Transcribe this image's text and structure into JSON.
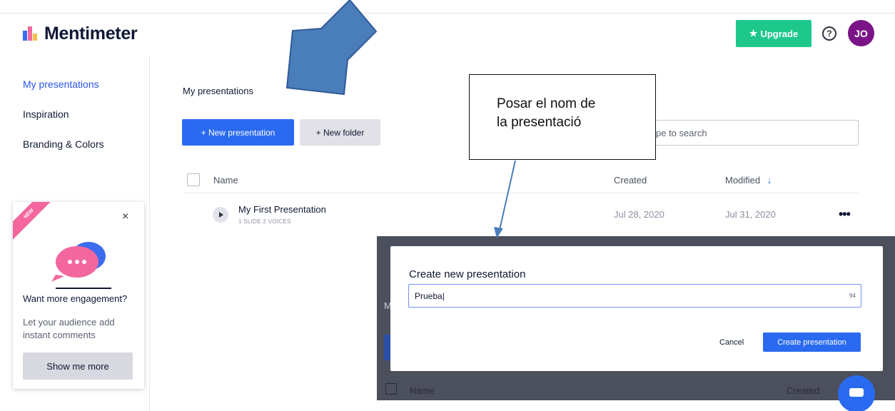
{
  "header": {
    "app_name": "Mentimeter",
    "upgrade_label": "Upgrade",
    "help_label": "?",
    "avatar_initials": "JO"
  },
  "sidebar": {
    "items": [
      {
        "label": "My presentations",
        "active": true
      },
      {
        "label": "Inspiration",
        "active": false
      },
      {
        "label": "Branding & Colors",
        "active": false
      }
    ],
    "promo": {
      "badge": "NEW",
      "close": "×",
      "title": "Want more engagement?",
      "text": "Let your audience add instant comments",
      "button": "Show me more"
    }
  },
  "main": {
    "title": "My presentations",
    "new_presentation_label": "+ New presentation",
    "new_folder_label": "+ New folder",
    "search_placeholder": "pe to search",
    "columns": {
      "name": "Name",
      "created": "Created",
      "modified": "Modified"
    },
    "rows": [
      {
        "name": "My First Presentation",
        "meta": "1 SLIDE  2 VOICES",
        "created": "Jul 28, 2020",
        "modified": "Jul 31, 2020"
      }
    ],
    "row_menu": "•••"
  },
  "background_behind_modal": {
    "partial_char": "M",
    "name_header": "Name",
    "created_header": "Created"
  },
  "modal": {
    "title": "Create new presentation",
    "input_value": "Prueba|",
    "char_count": "94",
    "cancel_label": "Cancel",
    "create_label": "Create presentation"
  },
  "annotation": {
    "callout_text_line1": "Posar el nom de",
    "callout_text_line2": "la presentació",
    "arrow_color": "#4a7ebb"
  },
  "colors": {
    "accent_blue": "#2a6af0",
    "upgrade_green": "#1ec88c",
    "avatar_purple": "#7b1487",
    "active_nav": "#2a54e8"
  }
}
